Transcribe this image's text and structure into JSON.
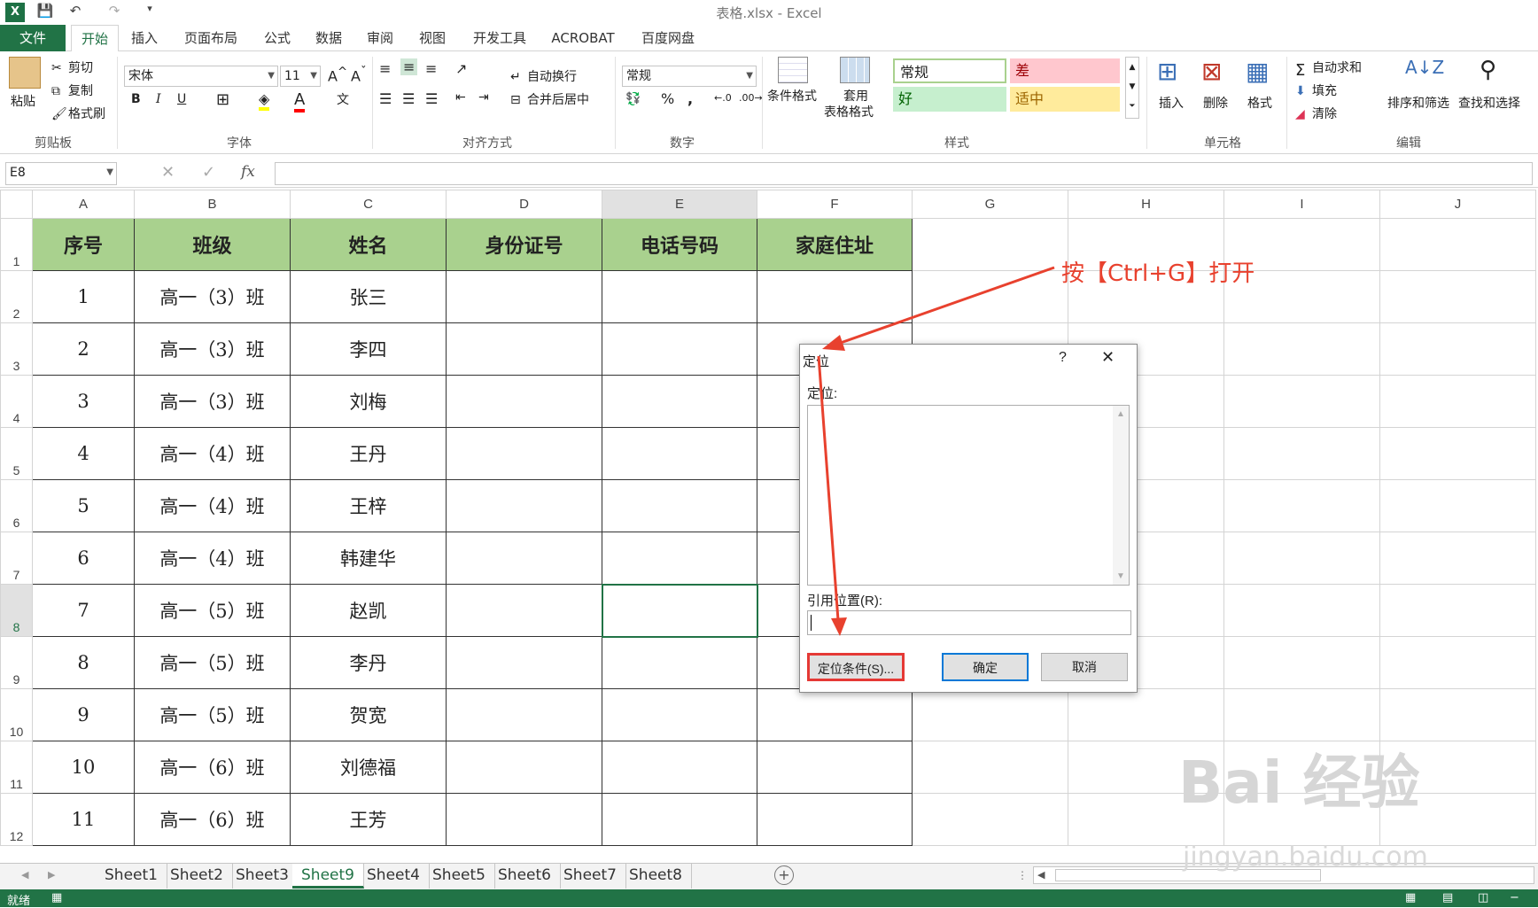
{
  "app": {
    "title": "表格.xlsx - Excel"
  },
  "ribbon_tabs": [
    "文件",
    "开始",
    "插入",
    "页面布局",
    "公式",
    "数据",
    "审阅",
    "视图",
    "开发工具",
    "ACROBAT",
    "百度网盘"
  ],
  "ribbon": {
    "clipboard": {
      "paste": "粘贴",
      "cut": "剪切",
      "copy": "复制",
      "format_painter": "格式刷",
      "label": "剪贴板"
    },
    "font": {
      "name": "宋体",
      "size": "11",
      "bold": "B",
      "italic": "I",
      "underline": "U",
      "font_color": "A",
      "label": "字体"
    },
    "alignment": {
      "wrap": "自动换行",
      "merge": "合并后居中",
      "label": "对齐方式"
    },
    "number": {
      "format": "常规",
      "percent": "%",
      "comma": ",",
      "label": "数字"
    },
    "styles": {
      "conditional": "条件格式",
      "table_line1": "套用",
      "table_line2": "表格格式",
      "normal": "常规",
      "bad": "差",
      "good": "好",
      "neutral": "适中",
      "label": "样式"
    },
    "cells": {
      "insert": "插入",
      "delete": "删除",
      "format": "格式",
      "label": "单元格"
    },
    "editing": {
      "autosum": "自动求和",
      "fill": "填充",
      "clear": "清除",
      "sort": "排序和筛选",
      "find": "查找和选择",
      "label": "编辑"
    }
  },
  "formula_bar": {
    "name_box": "E8",
    "fx": "fx",
    "value": ""
  },
  "columns": [
    "A",
    "B",
    "C",
    "D",
    "E",
    "F",
    "G",
    "H",
    "I",
    "J"
  ],
  "table": {
    "headers": [
      "序号",
      "班级",
      "姓名",
      "身份证号",
      "电话号码",
      "家庭住址"
    ],
    "rows": [
      [
        "1",
        "高一（3）班",
        "张三"
      ],
      [
        "2",
        "高一（3）班",
        "李四"
      ],
      [
        "3",
        "高一（3）班",
        "刘梅"
      ],
      [
        "4",
        "高一（4）班",
        "王丹"
      ],
      [
        "5",
        "高一（4）班",
        "王梓"
      ],
      [
        "6",
        "高一（4）班",
        "韩建华"
      ],
      [
        "7",
        "高一（5）班",
        "赵凯"
      ],
      [
        "8",
        "高一（5）班",
        "李丹"
      ],
      [
        "9",
        "高一（5）班",
        "贺宽"
      ],
      [
        "10",
        "高一（6）班",
        "刘德福"
      ],
      [
        "11",
        "高一（6）班",
        "王芳"
      ]
    ],
    "row_numbers": [
      "1",
      "2",
      "3",
      "4",
      "5",
      "6",
      "7",
      "8",
      "9",
      "10",
      "11",
      "12"
    ]
  },
  "sheets": [
    "Sheet1",
    "Sheet2",
    "Sheet3",
    "Sheet9",
    "Sheet4",
    "Sheet5",
    "Sheet6",
    "Sheet7",
    "Sheet8"
  ],
  "active_sheet": "Sheet9",
  "status": {
    "ready": "就绪"
  },
  "dialog": {
    "title": "定位",
    "help": "?",
    "close": "✕",
    "goto_label": "定位:",
    "reference_label": "引用位置(R):",
    "reference_value": "",
    "special_button": "定位条件(S)...",
    "ok_button": "确定",
    "cancel_button": "取消"
  },
  "annotation": {
    "text": "按【Ctrl+G】打开"
  },
  "watermark": {
    "text": "Bai 经验",
    "sub": "jingyan.baidu.com"
  },
  "colors": {
    "excel_green": "#217346",
    "header_fill": "#a9d18e",
    "annotation_red": "#e8412e"
  }
}
